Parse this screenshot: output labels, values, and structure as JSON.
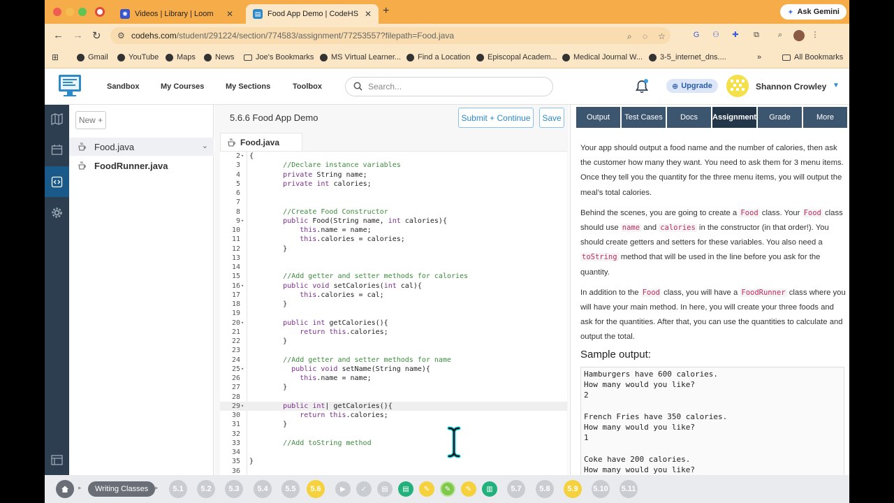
{
  "browser": {
    "tabs": [
      {
        "title": "Videos | Library | Loom",
        "active": false
      },
      {
        "title": "Food App Demo | CodeHS",
        "active": true
      }
    ],
    "ask_gemini": "Ask Gemini",
    "url_host": "codehs.com",
    "url_path": "/student/291224/section/774583/assignment/77253557?filepath=Food.java",
    "bookmarks": [
      "Gmail",
      "YouTube",
      "Maps",
      "News",
      "Joe's Bookmarks",
      "MS Virtual Learner...",
      "Find a Location",
      "Episcopal Academ...",
      "Medical Journal W...",
      "3-5_internet_dns...."
    ],
    "all_bookmarks": "All Bookmarks",
    "overflow": "»"
  },
  "header": {
    "nav": [
      "Sandbox",
      "My Courses",
      "My Sections",
      "Toolbox"
    ],
    "search_placeholder": "Search...",
    "upgrade": "Upgrade",
    "user_name": "Shannon Crowley"
  },
  "files": {
    "new_label": "New +",
    "items": [
      "Food.java",
      "FoodRunner.java"
    ]
  },
  "editor": {
    "title": "5.6.6 Food App Demo",
    "submit": "Submit + Continue",
    "save": "Save",
    "tab": "Food.java"
  },
  "panel": {
    "tabs": [
      "Output",
      "Test Cases",
      "Docs",
      "Assignment",
      "Grade",
      "More"
    ],
    "active_tab": "Assignment",
    "p1": "Your app should output a food name and the number of calories, then ask the customer how many they want. You need to ask them for 3 menu items. Once they tell you the quantity for the three menu items, you will output the meal’s total calories.",
    "p2_a": "Behind the scenes, you are going to create a ",
    "p2_food": "Food",
    "p2_b": " class. Your ",
    "p2_food2": "Food",
    "p2_c": " class should use ",
    "p2_name": "name",
    "p2_d": " and ",
    "p2_cal": "calories",
    "p2_e": " in the constructor (in that order!). You should create getters and setters for these variables. You also need a ",
    "p2_tostring": "toString",
    "p2_f": " method that will be used in the line before you ask for the quantity.",
    "p3_a": "In addition to the ",
    "p3_food": "Food",
    "p3_b": " class, you will have a ",
    "p3_runner": "FoodRunner",
    "p3_c": " class where you will have your main method. In here, you will create your three foods and ask for the quantities. After that, you can use the quantities to calculate and output the total.",
    "sample_heading": "Sample output:",
    "sample_output": "Hamburgers have 600 calories.\nHow many would you like?\n2\n\nFrench Fries have 350 calories.\nHow many would you like?\n1\n\nCoke have 200 calories.\nHow many would you like?"
  },
  "lessonbar": {
    "crumb": "Writing Classes",
    "units_before": [
      "5.1",
      "5.2",
      "5.3",
      "5.4",
      "5.5"
    ],
    "current": "5.6",
    "units_after": [
      "5.7",
      "5.8",
      "5.9",
      "5.10",
      "5.11"
    ]
  },
  "colors": {
    "tabbar": "#f6ad49",
    "panel_tab": "#3d5670",
    "panel_tab_active": "#243649",
    "accent": "#2d89c8",
    "unit_done": "#f4d13d"
  }
}
